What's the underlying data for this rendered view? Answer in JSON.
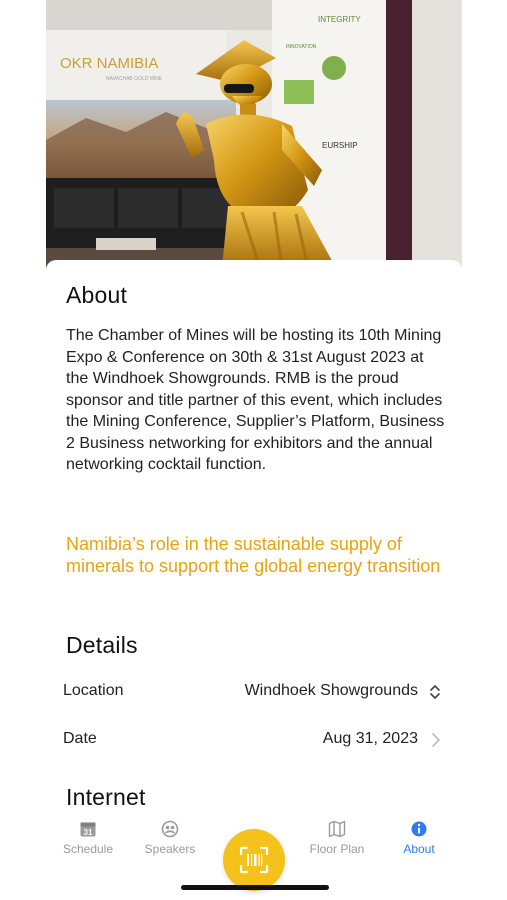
{
  "hero": {
    "booth_sign": "OKR NAMIBIA",
    "booth_subsign": "NAVACHAB GOLD MINE",
    "banner_words": [
      "INTEGRITY",
      "INNOVATION",
      "EURSHIP"
    ],
    "more_icon": "more-dots-icon"
  },
  "about": {
    "title": "About",
    "description": "The Chamber of Mines will be hosting its 10th Mining Expo & Conference on 30th & 31st August 2023 at the Windhoek Showgrounds. RMB is the proud sponsor and title partner of this event, which includes the Mining Conference, Supplier’s Platform, Business 2 Business networking for exhibitors and the annual networking cocktail function.",
    "theme": "Namibia’s role in the sustainable supply of minerals to support the global energy transition",
    "theme_color": "#e9a310"
  },
  "details": {
    "title": "Details",
    "location_label": "Location",
    "location_value": "Windhoek Showgrounds",
    "date_label": "Date",
    "date_value": "Aug 31, 2023"
  },
  "internet": {
    "title": "Internet"
  },
  "tabbar": {
    "active_color": "#2f7cf0",
    "tabs": [
      {
        "label": "Schedule",
        "icon": "calendar-icon",
        "active": false
      },
      {
        "label": "Speakers",
        "icon": "speakers-icon",
        "active": false
      },
      {
        "label": "Floor Plan",
        "icon": "map-icon",
        "active": false
      },
      {
        "label": "About",
        "icon": "info-icon",
        "active": true
      }
    ],
    "scan_icon": "barcode-scan-icon",
    "scan_color": "#f4c21b"
  },
  "calendar_day": "31"
}
